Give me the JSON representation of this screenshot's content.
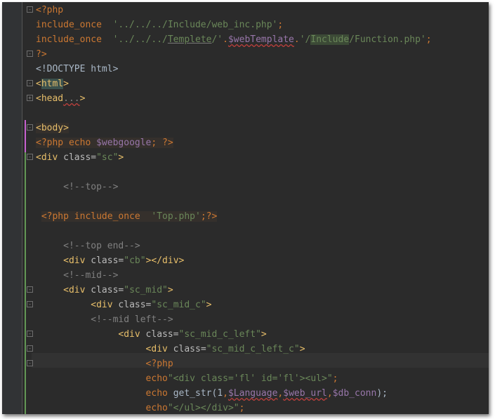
{
  "editor": {
    "lines": [
      [
        {
          "t": "<?php",
          "c": "php"
        }
      ],
      [
        {
          "t": "include_once",
          "c": "kw"
        },
        {
          "t": "  "
        },
        {
          "t": "'../../../Include/web_inc.php'",
          "c": "str"
        },
        {
          "t": ";",
          "c": "kw"
        }
      ],
      [
        {
          "t": "include_once",
          "c": "kw"
        },
        {
          "t": "  "
        },
        {
          "t": "'../../../",
          "c": "str"
        },
        {
          "t": "Templete",
          "c": "str under2"
        },
        {
          "t": "/'",
          "c": "str"
        },
        {
          "t": ".",
          "c": "kw"
        },
        {
          "t": "$webTemplate",
          "c": "var under"
        },
        {
          "t": ".",
          "c": "kw"
        },
        {
          "t": "'/",
          "c": "str"
        },
        {
          "t": "Include",
          "c": "str hl-include"
        },
        {
          "t": "/Function.php'",
          "c": "str"
        },
        {
          "t": ";",
          "c": "kw"
        }
      ],
      [
        {
          "t": "?>",
          "c": "php"
        }
      ],
      [
        {
          "t": "<!DOCTYPE html>",
          "c": "txt"
        }
      ],
      [
        {
          "t": "<",
          "c": "tag"
        },
        {
          "t": "html",
          "c": "tag hl-tag"
        },
        {
          "t": ">",
          "c": "tag"
        }
      ],
      [
        {
          "t": "<head",
          "c": "tag"
        },
        {
          "t": "...",
          "c": "cm under"
        },
        {
          "t": ">",
          "c": "tag"
        }
      ],
      [],
      [
        {
          "t": "<body>",
          "c": "tag hl-php-bg"
        }
      ],
      [
        {
          "t": "<?php",
          "c": "php hl-php-bg"
        },
        {
          "t": " echo ",
          "c": "kw hl-php-bg"
        },
        {
          "t": "$webgoogle",
          "c": "var hl-php-bg"
        },
        {
          "t": "; ",
          "c": "kw hl-php-bg"
        },
        {
          "t": "?>",
          "c": "php hl-php-bg"
        }
      ],
      [
        {
          "t": "<div",
          "c": "tag"
        },
        {
          "t": " class=",
          "c": "attr"
        },
        {
          "t": "\"sc\"",
          "c": "str"
        },
        {
          "t": ">",
          "c": "tag"
        }
      ],
      [],
      [
        {
          "t": "     "
        },
        {
          "t": "<!--top-->",
          "c": "cm"
        }
      ],
      [],
      [
        {
          "t": " "
        },
        {
          "t": "<?php",
          "c": "php hl-php-bg"
        },
        {
          "t": " include_once  ",
          "c": "kw hl-php-bg"
        },
        {
          "t": "'Top.php'",
          "c": "str hl-php-bg"
        },
        {
          "t": ";",
          "c": "kw hl-php-bg"
        },
        {
          "t": "?>",
          "c": "php hl-php-bg"
        }
      ],
      [],
      [
        {
          "t": "     "
        },
        {
          "t": "<!--top end-->",
          "c": "cm"
        }
      ],
      [
        {
          "t": "     "
        },
        {
          "t": "<div",
          "c": "tag"
        },
        {
          "t": " class=",
          "c": "attr"
        },
        {
          "t": "\"cb\"",
          "c": "str"
        },
        {
          "t": "></div>",
          "c": "tag"
        }
      ],
      [
        {
          "t": "     "
        },
        {
          "t": "<!--mid-->",
          "c": "cm"
        }
      ],
      [
        {
          "t": "     "
        },
        {
          "t": "<div",
          "c": "tag"
        },
        {
          "t": " class=",
          "c": "attr"
        },
        {
          "t": "\"sc_mid\"",
          "c": "str"
        },
        {
          "t": ">",
          "c": "tag"
        }
      ],
      [
        {
          "t": "          "
        },
        {
          "t": "<div",
          "c": "tag"
        },
        {
          "t": " class=",
          "c": "attr"
        },
        {
          "t": "\"sc_mid_c\"",
          "c": "str"
        },
        {
          "t": ">",
          "c": "tag"
        }
      ],
      [
        {
          "t": "          "
        },
        {
          "t": "<!--mid left-->",
          "c": "cm"
        }
      ],
      [
        {
          "t": "               "
        },
        {
          "t": "<div",
          "c": "tag"
        },
        {
          "t": " class=",
          "c": "attr"
        },
        {
          "t": "\"sc_mid_c_left\"",
          "c": "str"
        },
        {
          "t": ">",
          "c": "tag"
        }
      ],
      [
        {
          "t": "                    "
        },
        {
          "t": "<div",
          "c": "tag"
        },
        {
          "t": " class=",
          "c": "attr"
        },
        {
          "t": "\"sc_mid_c_left_c\"",
          "c": "str"
        },
        {
          "t": ">",
          "c": "tag"
        }
      ],
      [
        {
          "t": "                    "
        },
        {
          "t": "<?php",
          "c": "php"
        }
      ],
      [
        {
          "t": "                    "
        },
        {
          "t": "echo",
          "c": "kw"
        },
        {
          "t": "\"<div class='fl' id='fl'><ul>\"",
          "c": "str"
        },
        {
          "t": ";",
          "c": "kw"
        }
      ],
      [
        {
          "t": "                    "
        },
        {
          "t": "echo ",
          "c": "kw"
        },
        {
          "t": "get_str",
          "c": "txt"
        },
        {
          "t": "(",
          "c": "txt"
        },
        {
          "t": "1",
          "c": "txt"
        },
        {
          "t": ",",
          "c": "kw"
        },
        {
          "t": "$Language",
          "c": "var under"
        },
        {
          "t": ",",
          "c": "kw"
        },
        {
          "t": "$web_url",
          "c": "var under"
        },
        {
          "t": ",",
          "c": "kw"
        },
        {
          "t": "$db_conn",
          "c": "var"
        },
        {
          "t": ");",
          "c": "txt"
        }
      ],
      [
        {
          "t": "                    "
        },
        {
          "t": "echo",
          "c": "kw"
        },
        {
          "t": "\"</ul></div>\"",
          "c": "str"
        },
        {
          "t": ";",
          "c": "kw"
        }
      ]
    ]
  }
}
